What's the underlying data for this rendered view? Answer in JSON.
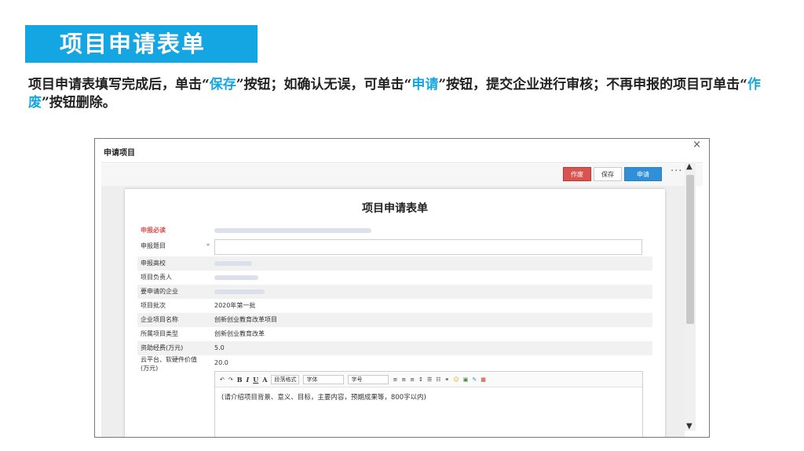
{
  "slide": {
    "title": "项目申请表单",
    "intro": {
      "p1": "项目申请表填写完成后，单击“",
      "save": "保存",
      "p2": "”按钮；如确认无误，可单击“",
      "apply": "申请",
      "p3": "”按钮，提交企业进行审核；不再申报的项目可单击“",
      "void": "作废",
      "p4": "”按钮删除。"
    }
  },
  "dialog": {
    "title": "申请项目",
    "close": "×",
    "buttons": {
      "void": "作废",
      "save": "保存",
      "apply": "申请",
      "more": "···"
    },
    "form": {
      "title": "项目申请表单",
      "rows": [
        {
          "label": "申报必读",
          "value": ""
        },
        {
          "label": "申报题目",
          "value": ""
        },
        {
          "label": "申报高校",
          "value": ""
        },
        {
          "label": "项目负责人",
          "value": ""
        },
        {
          "label": "要申请的企业",
          "value": ""
        },
        {
          "label": "项目批次",
          "value": "2020年第一批"
        },
        {
          "label": "企业项目名称",
          "value": "创新创业教育改革项目"
        },
        {
          "label": "所属项目类型",
          "value": "创新创业教育改革"
        },
        {
          "label": "资助经费(万元)",
          "value": "5.0"
        },
        {
          "label": "云平台、软硬件价值(万元)",
          "value": "20.0"
        }
      ],
      "required_mark": "*",
      "editor": {
        "tools": {
          "undo": "↶",
          "redo": "↷",
          "bold": "B",
          "italic": "I",
          "underline": "U",
          "color": "A",
          "para": "段落格式",
          "font": "字体",
          "size": "字号"
        },
        "placeholder": "(请介绍项目背景、意义、目标，主要内容，预期成果等，800字以内)"
      }
    }
  }
}
